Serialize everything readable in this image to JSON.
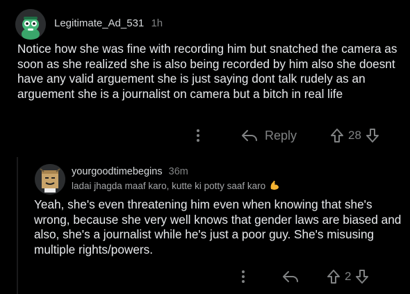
{
  "comment": {
    "username": "Legitimate_Ad_531",
    "age": "1h",
    "body": "Notice how she was fine with recording him but snatched the camera as soon as she realized she is also being recorded by him also she doesnt have any valid arguement she is just saying dont talk rudely as an arguement she is a journalist on camera but a bitch in real life",
    "reply_label": "Reply",
    "score": "28"
  },
  "reply": {
    "username": "yourgoodtimebegins",
    "age": "36m",
    "flair": "ladai jhagda maaf karo, kutte ki potty saaf karo",
    "flair_emoji": "flexed-biceps-icon",
    "body": "Yeah, she's even threatening him even when knowing that she's wrong, because she very well knows that gender laws are biased and also, she's a journalist while he's just a poor guy. She's misusing multiple rights/powers.",
    "score": "2"
  },
  "colors": {
    "background": "#000000",
    "text": "#e8eaed",
    "muted": "#818384"
  }
}
